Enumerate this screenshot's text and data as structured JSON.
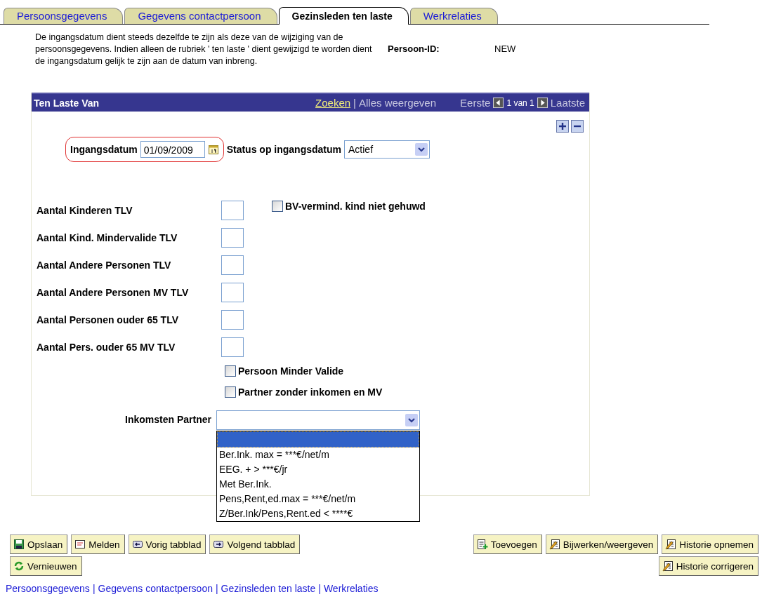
{
  "tabs": [
    {
      "label": "Persoonsgegevens",
      "selected": false
    },
    {
      "label": "Gegevens contactpersoon",
      "selected": false
    },
    {
      "label": "Gezinsleden ten laste",
      "selected": true
    },
    {
      "label": "Werkrelaties",
      "selected": false
    }
  ],
  "intro": "De ingangsdatum dient steeds dezelfde te zijn als deze van de wijziging van de persoonsgegevens. Indien alleen de rubriek ' ten laste ' dient gewijzigd te worden dient de ingangsdatum gelijk te zijn aan de datum van inbreng.",
  "person_id": {
    "label": "Persoon-ID:",
    "value": "NEW"
  },
  "panel": {
    "title": "Ten Laste Van",
    "links": [
      {
        "kind": "link",
        "text": "Zoeken"
      },
      {
        "kind": "separator",
        "text": "|"
      },
      {
        "kind": "plain",
        "text": "Alles weergeven"
      }
    ],
    "nav": {
      "first": "Eerste",
      "count": "1 van 1",
      "last": "Laatste"
    },
    "effective_date": {
      "label": "Ingangsdatum",
      "value": "01/09/2009"
    },
    "status": {
      "label": "Status op ingangsdatum",
      "value": "Actief"
    },
    "fields": [
      {
        "label": "Aantal Kinderen TLV"
      },
      {
        "label": "Aantal Kind. Mindervalide TLV"
      },
      {
        "label": "Aantal Andere Personen TLV"
      },
      {
        "label": "Aantal Andere Personen MV TLV"
      },
      {
        "label": "Aantal Personen ouder 65 TLV"
      },
      {
        "label": "Aantal Pers. ouder 65 MV TLV"
      }
    ],
    "side_checkbox": {
      "label": "BV-vermind. kind niet gehuwd",
      "checked": false
    },
    "checkboxes": [
      {
        "label": "Persoon Minder Valide",
        "checked": false
      },
      {
        "label": "Partner zonder inkomen en MV",
        "checked": false
      }
    ],
    "income": {
      "label": "Inkomsten Partner",
      "options": [
        {
          "selected": true
        },
        {
          "text": "Ber.Ink. max = ***€/net/m",
          "selected": false
        },
        {
          "text": "EEG. + > ***€/jr",
          "selected": false
        },
        {
          "text": "Met Ber.Ink.",
          "selected": false
        },
        {
          "text": "Pens,Rent,ed.max = ***€/net/m",
          "selected": false
        },
        {
          "text": "Z/Ber.Ink/Pens,Rent.ed < ****€",
          "selected": false
        }
      ]
    }
  },
  "button_rows": [
    {
      "left": [
        {
          "label": "Opslaan",
          "kind": "save"
        },
        {
          "label": "Melden",
          "kind": "notify"
        },
        {
          "label": "Vorig tabblad",
          "kind": "prev"
        },
        {
          "label": "Volgend tabblad",
          "kind": "next"
        }
      ],
      "right": [
        {
          "label": "Toevoegen",
          "kind": "add"
        },
        {
          "label": "Bijwerken/weergeven",
          "kind": "edit"
        },
        {
          "label": "Historie opnemen",
          "kind": "history"
        }
      ]
    },
    {
      "left": [
        {
          "label": "Vernieuwen",
          "kind": "refresh"
        }
      ],
      "right": [
        {
          "label": "Historie corrigeren",
          "kind": "correct"
        }
      ]
    }
  ],
  "bottom_links": [
    {
      "text": "Persoonsgegevens",
      "separator": "|"
    },
    {
      "text": "Gegevens contactpersoon",
      "separator": "|"
    },
    {
      "text": "Gezinsleden ten laste",
      "separator": "|"
    },
    {
      "text": "Werkrelaties"
    }
  ]
}
